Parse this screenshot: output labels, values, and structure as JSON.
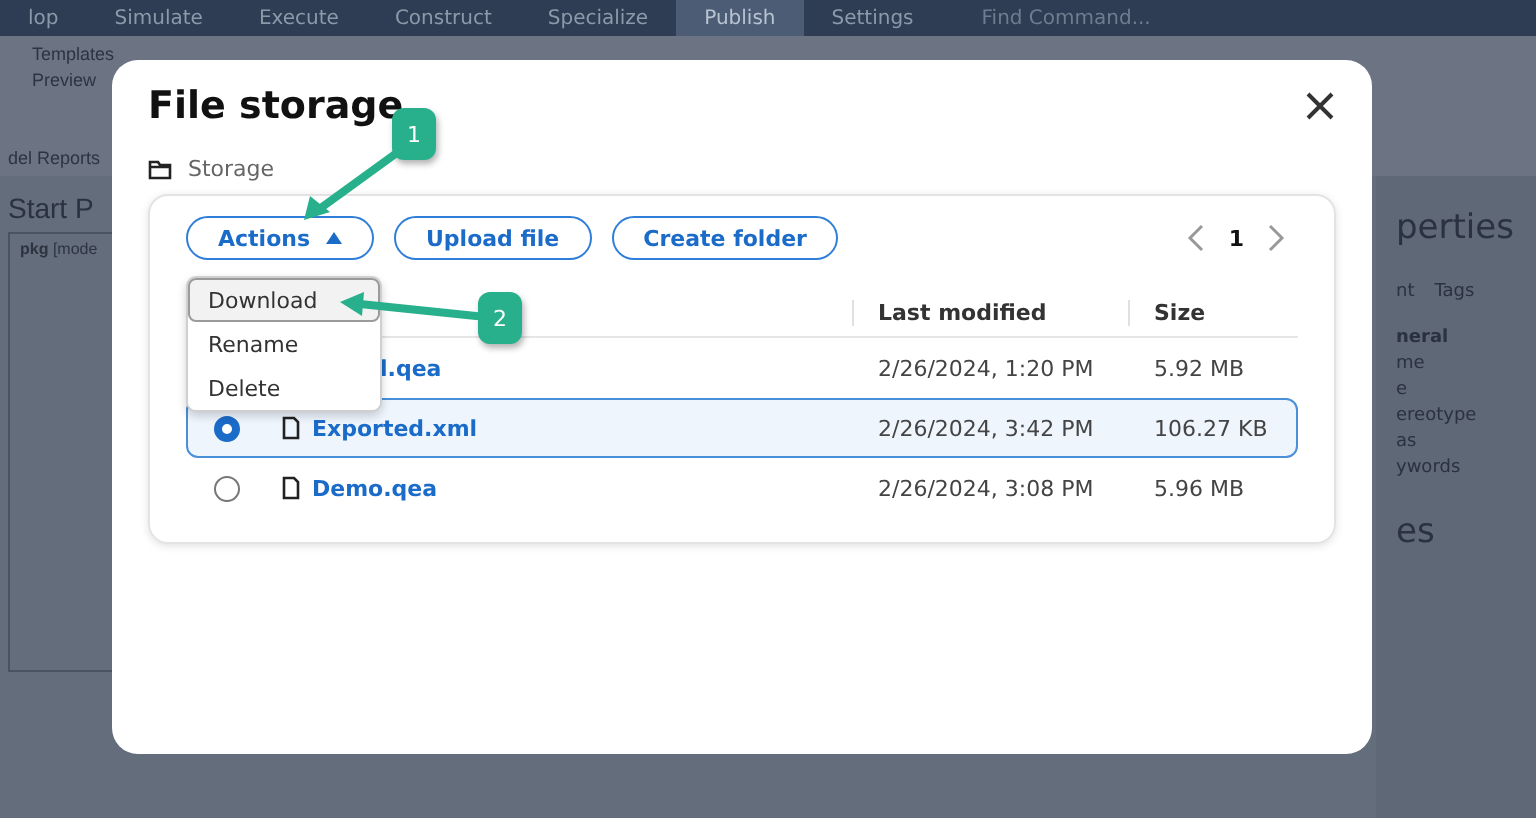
{
  "app": {
    "menu_tabs": [
      {
        "label": "lop",
        "selected": false
      },
      {
        "label": "Simulate",
        "selected": false
      },
      {
        "label": "Execute",
        "selected": false
      },
      {
        "label": "Construct",
        "selected": false
      },
      {
        "label": "Specialize",
        "selected": false
      },
      {
        "label": "Publish",
        "selected": true
      },
      {
        "label": "Settings",
        "selected": false
      }
    ],
    "search": {
      "placeholder": "Find Command..."
    },
    "ribbon_items": [
      "Templates",
      "Preview"
    ],
    "ribbon_group": "del Reports",
    "diagram_title": "Start P",
    "diagram_frame": "**pkg** [mode",
    "properties": {
      "title": "perties",
      "tabs": [
        "nt",
        "Tags"
      ],
      "rows": [
        {
          "label": "neral",
          "kind": "header"
        },
        {
          "label": "me",
          "kind": "field"
        },
        {
          "label": "e",
          "kind": "field"
        },
        {
          "label": "ereotype",
          "kind": "field"
        },
        {
          "label": "as",
          "kind": "field"
        },
        {
          "label": "ywords",
          "kind": "field"
        }
      ]
    },
    "notes_title": "es"
  },
  "dialog": {
    "title": "File storage",
    "breadcrumb": "Storage",
    "buttons": [
      {
        "label": "Actions",
        "kind": "dropdown",
        "expanded": true
      },
      {
        "label": "Upload file",
        "kind": "plain"
      },
      {
        "label": "Create folder",
        "kind": "plain"
      }
    ],
    "pager": {
      "page": "1"
    },
    "menu": [
      {
        "label": "Download",
        "selected": true
      },
      {
        "label": "Rename",
        "selected": false
      },
      {
        "label": "Delete",
        "selected": false
      }
    ],
    "columns": [
      "Last modified",
      "Size"
    ],
    "rows": [
      {
        "name": "l.qea",
        "modified": "2/26/2024, 1:20 PM",
        "size": "5.92 MB",
        "selected": false,
        "covered": true
      },
      {
        "name": "Exported.xml",
        "modified": "2/26/2024, 3:42 PM",
        "size": "106.27 KB",
        "selected": true,
        "covered": false
      },
      {
        "name": "Demo.qea",
        "modified": "2/26/2024, 3:08 PM",
        "size": "5.96 MB",
        "selected": false,
        "covered": false
      }
    ]
  },
  "callouts": [
    "1",
    "2"
  ]
}
